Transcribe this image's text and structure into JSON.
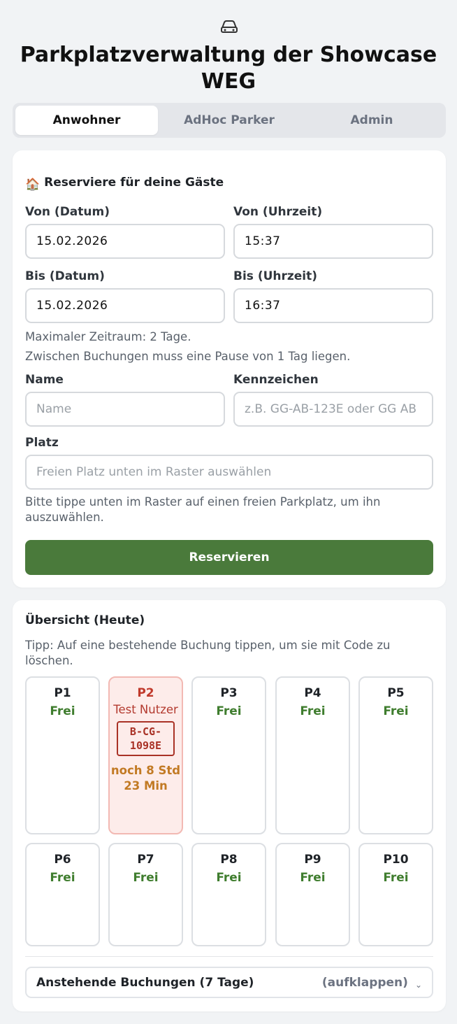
{
  "app": {
    "title": "Parkplatzverwaltung der Showcase WEG",
    "icon": "car-icon"
  },
  "tabs": [
    {
      "label": "Anwohner",
      "active": true
    },
    {
      "label": "AdHoc Parker",
      "active": false
    },
    {
      "label": "Admin",
      "active": false
    }
  ],
  "reserve": {
    "icon": "🏠",
    "heading": "Reserviere für deine Gäste",
    "from_date_label": "Von (Datum)",
    "from_date_value": "15.02.2026",
    "from_time_label": "Von (Uhrzeit)",
    "from_time_value": "15:37",
    "to_date_label": "Bis (Datum)",
    "to_date_value": "15.02.2026",
    "to_time_label": "Bis (Uhrzeit)",
    "to_time_value": "16:37",
    "note_max": "Maximaler Zeitraum: 2 Tage.",
    "note_pause": "Zwischen Buchungen muss eine Pause von 1 Tag liegen.",
    "name_label": "Name",
    "name_placeholder": "Name",
    "plate_label": "Kennzeichen",
    "plate_placeholder": "z.B. GG-AB-123E oder GG AB",
    "spot_label": "Platz",
    "spot_placeholder": "Freien Platz unten im Raster auswählen",
    "spot_hint": "Bitte tippe unten im Raster auf einen freien Parkplatz, um ihn auszuwählen.",
    "submit_label": "Reservieren"
  },
  "overview": {
    "heading": "Übersicht (Heute)",
    "tip": "Tipp: Auf eine bestehende Buchung tippen, um sie mit Code zu löschen.",
    "spots": [
      {
        "name": "P1",
        "status": "Frei"
      },
      {
        "name": "P2",
        "guest": "Test Nutzer",
        "plate": "B-CG-1098E",
        "remaining": "noch 8 Std 23 Min"
      },
      {
        "name": "P3",
        "status": "Frei"
      },
      {
        "name": "P4",
        "status": "Frei"
      },
      {
        "name": "P5",
        "status": "Frei"
      },
      {
        "name": "P6",
        "status": "Frei"
      },
      {
        "name": "P7",
        "status": "Frei"
      },
      {
        "name": "P8",
        "status": "Frei"
      },
      {
        "name": "P9",
        "status": "Frei"
      },
      {
        "name": "P10",
        "status": "Frei"
      }
    ],
    "upcoming_title": "Anstehende Buchungen (7 Tage)",
    "upcoming_hint": "(aufklappen)",
    "upcoming_icon": "chevron-down-icon"
  },
  "colors": {
    "accent_green": "#4a7a3b",
    "free_green": "#3f7d2e",
    "booked_red": "#c0392b",
    "remaining_orange": "#c27a24"
  }
}
